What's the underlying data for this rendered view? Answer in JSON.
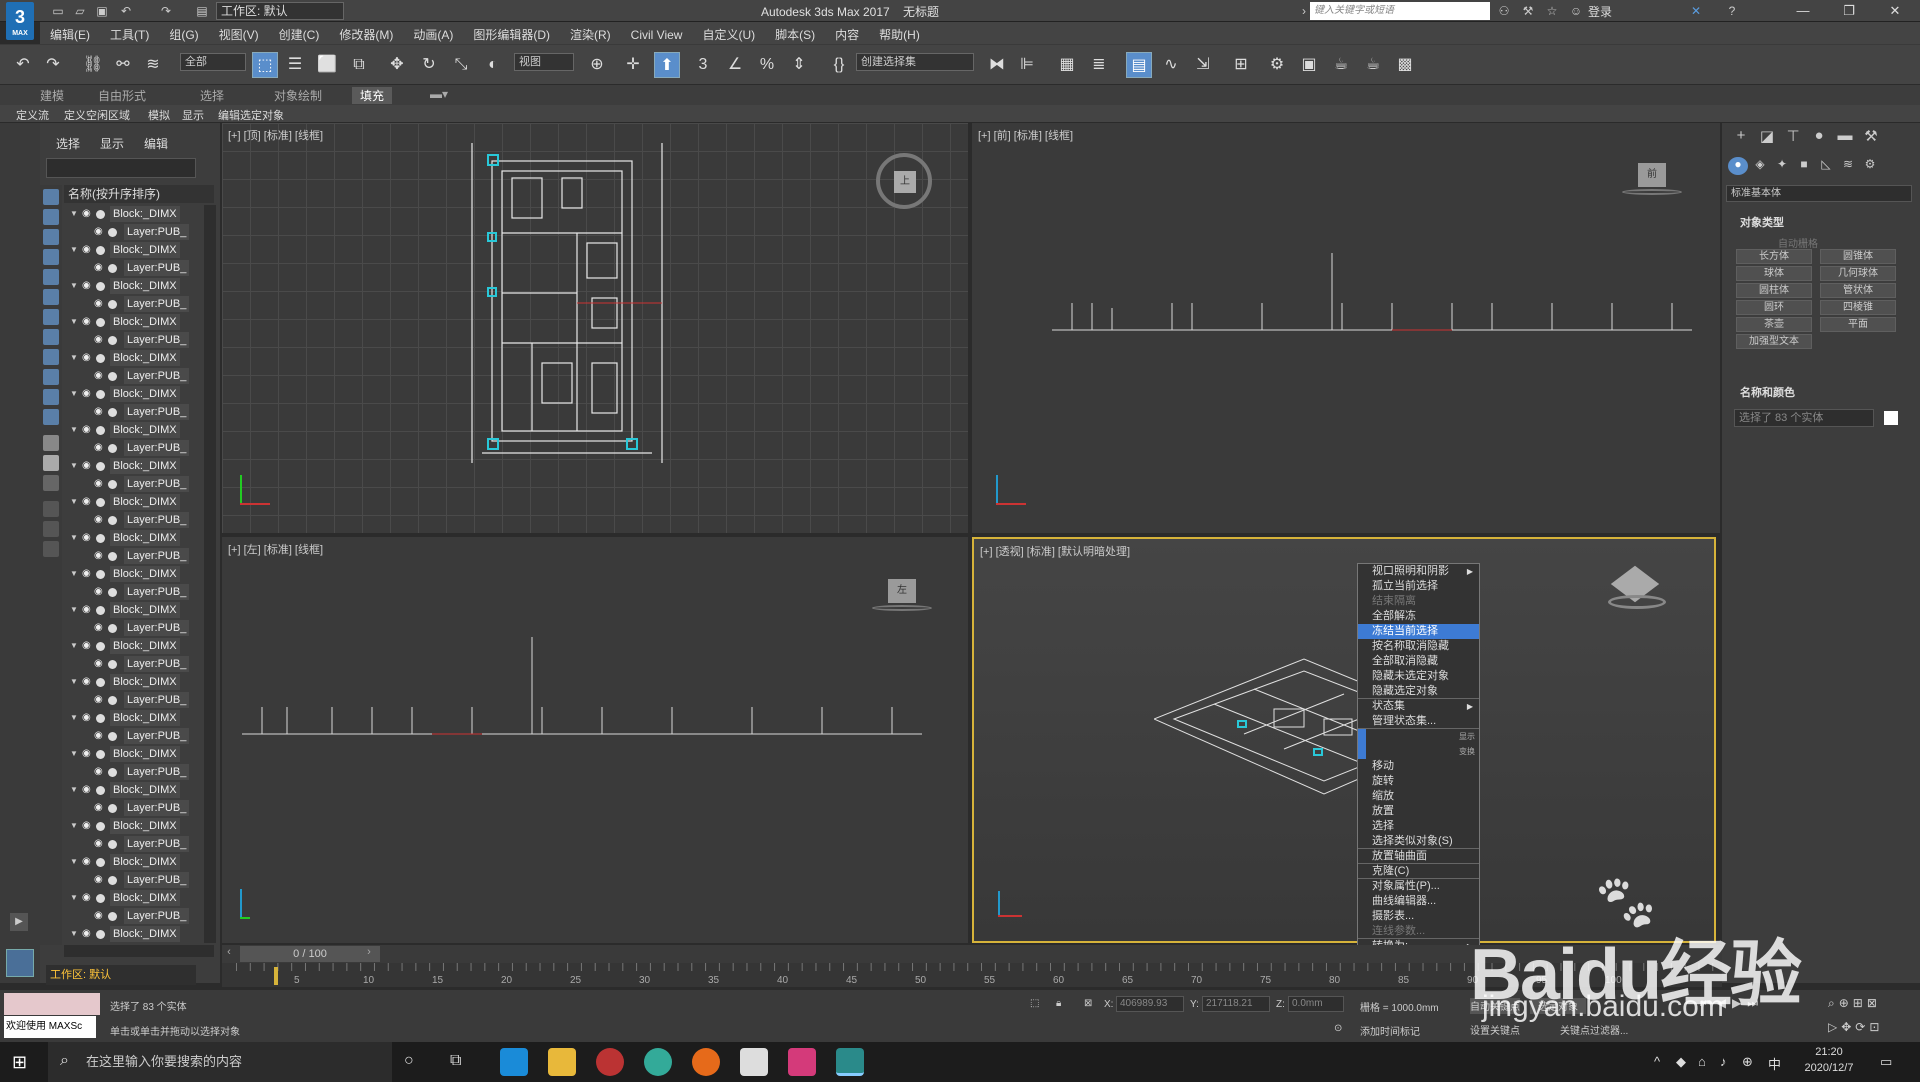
{
  "titlebar": {
    "workspace_dropdown": "工作区: 默认",
    "app_title": "Autodesk 3ds Max 2017",
    "doc_title": "无标题",
    "search_placeholder": "键入关键字或短语",
    "login": "登录",
    "logo_text": "3",
    "logo_sub": "MAX"
  },
  "menu": [
    "编辑(E)",
    "工具(T)",
    "组(G)",
    "视图(V)",
    "创建(C)",
    "修改器(M)",
    "动画(A)",
    "图形编辑器(D)",
    "渲染(R)",
    "Civil View",
    "自定义(U)",
    "脚本(S)",
    "内容",
    "帮助(H)"
  ],
  "toolbar": {
    "filter_dropdown": "全部",
    "coord_dropdown": "视图",
    "selset_dropdown": "创建选择集"
  },
  "ribbon": {
    "tabs": [
      "建模",
      "自由形式",
      "选择",
      "对象绘制",
      "填充"
    ],
    "active_tab": "填充",
    "sub_items": [
      "定义流",
      "定义空闲区域",
      "模拟",
      "显示",
      "编辑选定对象"
    ]
  },
  "explorer": {
    "tabs": [
      "选择",
      "显示",
      "编辑"
    ],
    "column_header": "名称(按升序排序)",
    "rows": [
      {
        "name": "Block:_DIMX",
        "child": false
      },
      {
        "name": "Layer:PUB_",
        "child": true
      },
      {
        "name": "Block:_DIMX",
        "child": false
      },
      {
        "name": "Layer:PUB_",
        "child": true
      },
      {
        "name": "Block:_DIMX",
        "child": false
      },
      {
        "name": "Layer:PUB_",
        "child": true
      },
      {
        "name": "Block:_DIMX",
        "child": false
      },
      {
        "name": "Layer:PUB_",
        "child": true
      },
      {
        "name": "Block:_DIMX",
        "child": false
      },
      {
        "name": "Layer:PUB_",
        "child": true
      },
      {
        "name": "Block:_DIMX",
        "child": false
      },
      {
        "name": "Layer:PUB_",
        "child": true
      },
      {
        "name": "Block:_DIMX",
        "child": false
      },
      {
        "name": "Layer:PUB_",
        "child": true
      },
      {
        "name": "Block:_DIMX",
        "child": false
      },
      {
        "name": "Layer:PUB_",
        "child": true
      },
      {
        "name": "Block:_DIMX",
        "child": false
      },
      {
        "name": "Layer:PUB_",
        "child": true
      },
      {
        "name": "Block:_DIMX",
        "child": false
      },
      {
        "name": "Layer:PUB_",
        "child": true
      },
      {
        "name": "Block:_DIMX",
        "child": false
      },
      {
        "name": "Layer:PUB_",
        "child": true
      },
      {
        "name": "Block:_DIMX",
        "child": false
      },
      {
        "name": "Layer:PUB_",
        "child": true
      },
      {
        "name": "Block:_DIMX",
        "child": false
      },
      {
        "name": "Layer:PUB_",
        "child": true
      },
      {
        "name": "Block:_DIMX",
        "child": false
      },
      {
        "name": "Layer:PUB_",
        "child": true
      },
      {
        "name": "Block:_DIMX",
        "child": false
      },
      {
        "name": "Layer:PUB_",
        "child": true
      },
      {
        "name": "Block:_DIMX",
        "child": false
      },
      {
        "name": "Layer:PUB_",
        "child": true
      },
      {
        "name": "Block:_DIMX",
        "child": false
      },
      {
        "name": "Layer:PUB_",
        "child": true
      },
      {
        "name": "Block:_DIMX",
        "child": false
      },
      {
        "name": "Layer:PUB_",
        "child": true
      },
      {
        "name": "Block:_DIMX",
        "child": false
      },
      {
        "name": "Layer:PUB_",
        "child": true
      },
      {
        "name": "Block:_DIMX",
        "child": false
      },
      {
        "name": "Layer:PUB_",
        "child": true
      },
      {
        "name": "Block:_DIMX",
        "child": false
      }
    ],
    "workspace_label": "工作区: 默认"
  },
  "viewports": {
    "top": "[+] [顶] [标准] [线框]",
    "front": "[+] [前] [标准] [线框]",
    "left": "[+] [左] [标准] [线框]",
    "persp": "[+] [透视] [标准] [默认明暗处理]",
    "cube_top": "上",
    "cube_front": "前",
    "cube_left": "左"
  },
  "context_menu": [
    {
      "label": "视口照明和阴影",
      "state": "normal",
      "arrow": true
    },
    {
      "label": "孤立当前选择",
      "state": "normal"
    },
    {
      "label": "结束隔离",
      "state": "disabled"
    },
    {
      "label": "全部解冻",
      "state": "normal"
    },
    {
      "label": "冻结当前选择",
      "state": "highlight"
    },
    {
      "label": "按名称取消隐藏",
      "state": "normal"
    },
    {
      "label": "全部取消隐藏",
      "state": "normal"
    },
    {
      "label": "隐藏未选定对象",
      "state": "normal"
    },
    {
      "label": "隐藏选定对象",
      "state": "normal",
      "sep": true
    },
    {
      "label": "状态集",
      "state": "normal",
      "arrow": true
    },
    {
      "label": "管理状态集...",
      "state": "normal",
      "sep": true
    },
    {
      "label": "显示",
      "state": "label"
    },
    {
      "label": "变换",
      "state": "label"
    },
    {
      "label": "移动",
      "state": "normal"
    },
    {
      "label": "旋转",
      "state": "normal"
    },
    {
      "label": "缩放",
      "state": "normal"
    },
    {
      "label": "放置",
      "state": "normal"
    },
    {
      "label": "选择",
      "state": "normal"
    },
    {
      "label": "选择类似对象(S)",
      "state": "normal",
      "sep": true
    },
    {
      "label": "放置轴曲面",
      "state": "normal",
      "sep": true
    },
    {
      "label": "克隆(C)",
      "state": "normal",
      "sep": true
    },
    {
      "label": "对象属性(P)...",
      "state": "normal"
    },
    {
      "label": "曲线编辑器...",
      "state": "normal"
    },
    {
      "label": "摄影表...",
      "state": "normal"
    },
    {
      "label": "连线参数...",
      "state": "disabled",
      "sep": true
    },
    {
      "label": "转换为:",
      "state": "normal",
      "arrow": true
    }
  ],
  "command_panel": {
    "dropdown": "标准基本体",
    "rollout_object_type": "对象类型",
    "auto_grid": "自动栅格",
    "buttons": [
      "长方体",
      "圆锥体",
      "球体",
      "几何球体",
      "圆柱体",
      "管状体",
      "圆环",
      "四棱锥",
      "茶壶",
      "平面",
      "加强型文本"
    ],
    "rollout_name_color": "名称和颜色",
    "name_field": "选择了 83 个实体"
  },
  "timeline": {
    "slider": "0 / 100",
    "ticks": [
      "5",
      "10",
      "15",
      "20",
      "25",
      "30",
      "35",
      "40",
      "45",
      "50",
      "55",
      "60",
      "65",
      "70",
      "75",
      "80",
      "85",
      "90",
      "95",
      "100"
    ]
  },
  "status": {
    "welcome": "欢迎使用 MAXSc",
    "selected": "选择了 83 个实体",
    "hint": "单击或单击并拖动以选择对象",
    "x_label": "X:",
    "x_value": "406989.93",
    "y_label": "Y:",
    "y_value": "217118.21",
    "z_label": "Z:",
    "z_value": "0.0mm",
    "grid": "栅格 = 1000.0mm",
    "add_time_tag": "添加时间标记",
    "auto_key": "自动关键点",
    "selected_obj": "选定对象",
    "set_key": "设置关键点",
    "key_filter": "关键点过滤器..."
  },
  "taskbar": {
    "search": "在这里输入你要搜索的内容",
    "time": "21:20",
    "date": "2020/12/7",
    "ime": "中"
  },
  "watermark": {
    "brand": "Baidu经验",
    "url": "jingyan.baidu.com"
  },
  "colors": {
    "accent": "#3d7bd4",
    "viewport_active_border": "#d6b33a",
    "workspace_label": "#ffc43a"
  }
}
